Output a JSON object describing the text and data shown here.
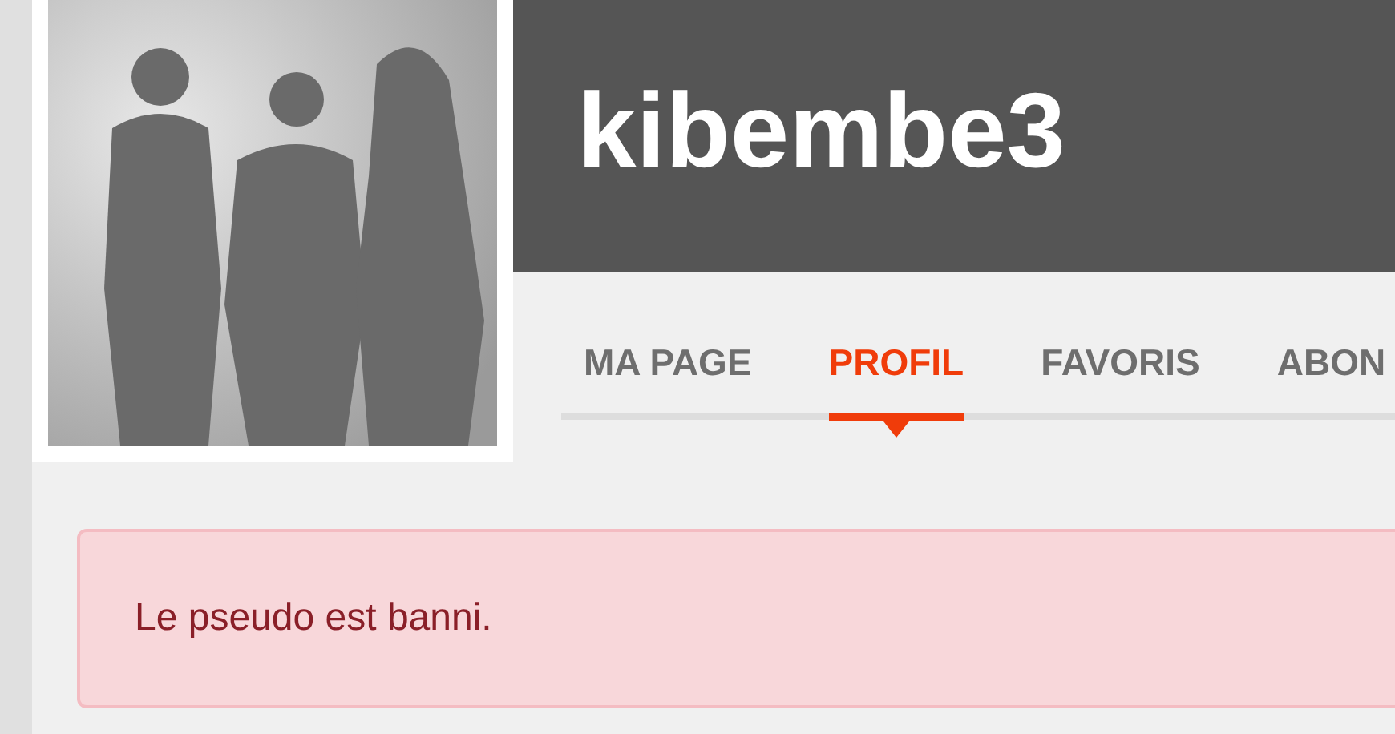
{
  "profile": {
    "username": "kibembe3"
  },
  "tabs": [
    {
      "label": "MA PAGE",
      "selected": false
    },
    {
      "label": "PROFIL",
      "selected": true
    },
    {
      "label": "FAVORIS",
      "selected": false
    },
    {
      "label": "ABON",
      "selected": false
    }
  ],
  "alert": {
    "message": "Le pseudo est banni."
  }
}
